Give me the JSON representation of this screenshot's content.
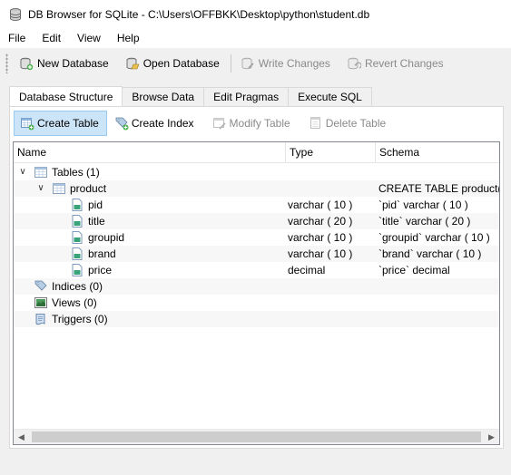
{
  "window": {
    "title": "DB Browser for SQLite - C:\\Users\\OFFBKK\\Desktop\\python\\student.db"
  },
  "menu": [
    "File",
    "Edit",
    "View",
    "Help"
  ],
  "toolbar": {
    "new_database": "New Database",
    "open_database": "Open Database",
    "write_changes": "Write Changes",
    "revert_changes": "Revert Changes"
  },
  "tabs": [
    "Database Structure",
    "Browse Data",
    "Edit Pragmas",
    "Execute SQL"
  ],
  "structure_toolbar": {
    "create_table": "Create Table",
    "create_index": "Create Index",
    "modify_table": "Modify Table",
    "delete_table": "Delete Table"
  },
  "tree": {
    "columns": [
      "Name",
      "Type",
      "Schema"
    ],
    "rows": [
      {
        "name": "Tables (1)",
        "type": "",
        "schema": ""
      },
      {
        "name": "product",
        "type": "",
        "schema": "CREATE TABLE product( p"
      },
      {
        "name": "pid",
        "type": "varchar ( 10 )",
        "schema": "`pid` varchar ( 10 )"
      },
      {
        "name": "title",
        "type": "varchar ( 20 )",
        "schema": "`title` varchar ( 20 )"
      },
      {
        "name": "groupid",
        "type": "varchar ( 10 )",
        "schema": "`groupid` varchar ( 10 )"
      },
      {
        "name": "brand",
        "type": "varchar ( 10 )",
        "schema": "`brand` varchar ( 10 )"
      },
      {
        "name": "price",
        "type": "decimal",
        "schema": "`price` decimal"
      },
      {
        "name": "Indices (0)",
        "type": "",
        "schema": ""
      },
      {
        "name": "Views (0)",
        "type": "",
        "schema": ""
      },
      {
        "name": "Triggers (0)",
        "type": "",
        "schema": ""
      }
    ]
  }
}
